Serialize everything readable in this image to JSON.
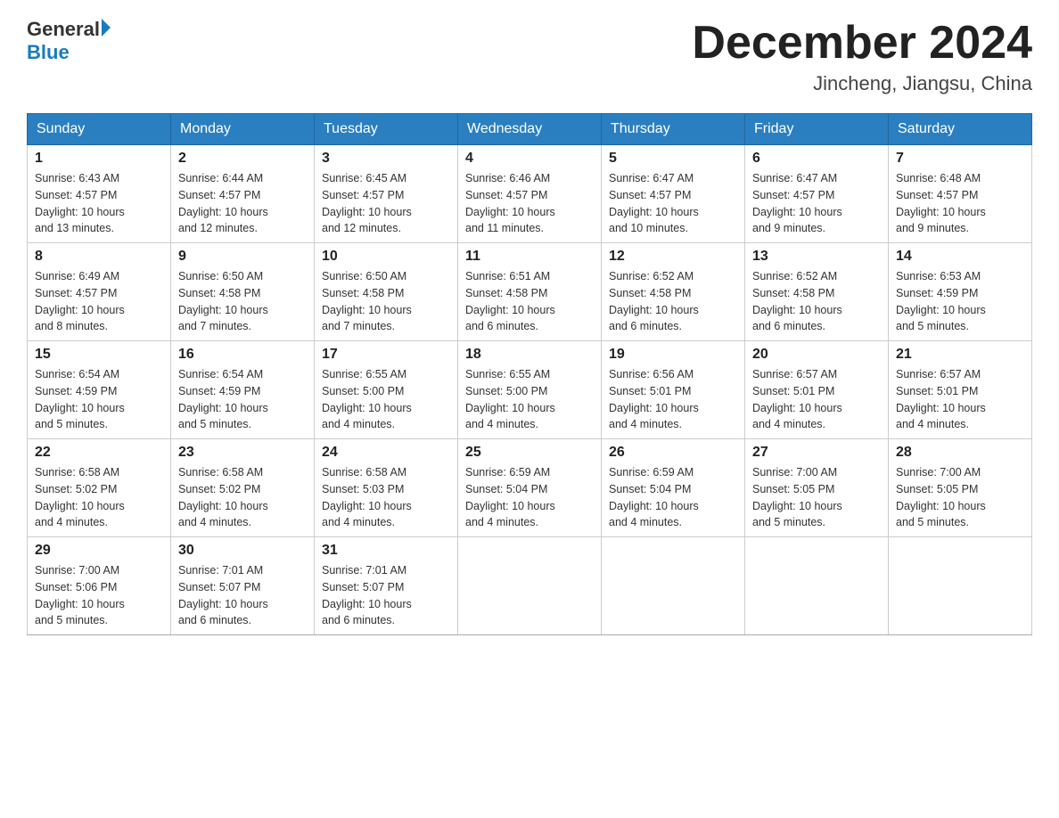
{
  "header": {
    "logo_general": "General",
    "logo_blue": "Blue",
    "month_title": "December 2024",
    "location": "Jincheng, Jiangsu, China"
  },
  "days_of_week": [
    "Sunday",
    "Monday",
    "Tuesday",
    "Wednesday",
    "Thursday",
    "Friday",
    "Saturday"
  ],
  "weeks": [
    [
      {
        "day": "1",
        "sunrise": "6:43 AM",
        "sunset": "4:57 PM",
        "daylight": "10 hours and 13 minutes."
      },
      {
        "day": "2",
        "sunrise": "6:44 AM",
        "sunset": "4:57 PM",
        "daylight": "10 hours and 12 minutes."
      },
      {
        "day": "3",
        "sunrise": "6:45 AM",
        "sunset": "4:57 PM",
        "daylight": "10 hours and 12 minutes."
      },
      {
        "day": "4",
        "sunrise": "6:46 AM",
        "sunset": "4:57 PM",
        "daylight": "10 hours and 11 minutes."
      },
      {
        "day": "5",
        "sunrise": "6:47 AM",
        "sunset": "4:57 PM",
        "daylight": "10 hours and 10 minutes."
      },
      {
        "day": "6",
        "sunrise": "6:47 AM",
        "sunset": "4:57 PM",
        "daylight": "10 hours and 9 minutes."
      },
      {
        "day": "7",
        "sunrise": "6:48 AM",
        "sunset": "4:57 PM",
        "daylight": "10 hours and 9 minutes."
      }
    ],
    [
      {
        "day": "8",
        "sunrise": "6:49 AM",
        "sunset": "4:57 PM",
        "daylight": "10 hours and 8 minutes."
      },
      {
        "day": "9",
        "sunrise": "6:50 AM",
        "sunset": "4:58 PM",
        "daylight": "10 hours and 7 minutes."
      },
      {
        "day": "10",
        "sunrise": "6:50 AM",
        "sunset": "4:58 PM",
        "daylight": "10 hours and 7 minutes."
      },
      {
        "day": "11",
        "sunrise": "6:51 AM",
        "sunset": "4:58 PM",
        "daylight": "10 hours and 6 minutes."
      },
      {
        "day": "12",
        "sunrise": "6:52 AM",
        "sunset": "4:58 PM",
        "daylight": "10 hours and 6 minutes."
      },
      {
        "day": "13",
        "sunrise": "6:52 AM",
        "sunset": "4:58 PM",
        "daylight": "10 hours and 6 minutes."
      },
      {
        "day": "14",
        "sunrise": "6:53 AM",
        "sunset": "4:59 PM",
        "daylight": "10 hours and 5 minutes."
      }
    ],
    [
      {
        "day": "15",
        "sunrise": "6:54 AM",
        "sunset": "4:59 PM",
        "daylight": "10 hours and 5 minutes."
      },
      {
        "day": "16",
        "sunrise": "6:54 AM",
        "sunset": "4:59 PM",
        "daylight": "10 hours and 5 minutes."
      },
      {
        "day": "17",
        "sunrise": "6:55 AM",
        "sunset": "5:00 PM",
        "daylight": "10 hours and 4 minutes."
      },
      {
        "day": "18",
        "sunrise": "6:55 AM",
        "sunset": "5:00 PM",
        "daylight": "10 hours and 4 minutes."
      },
      {
        "day": "19",
        "sunrise": "6:56 AM",
        "sunset": "5:01 PM",
        "daylight": "10 hours and 4 minutes."
      },
      {
        "day": "20",
        "sunrise": "6:57 AM",
        "sunset": "5:01 PM",
        "daylight": "10 hours and 4 minutes."
      },
      {
        "day": "21",
        "sunrise": "6:57 AM",
        "sunset": "5:01 PM",
        "daylight": "10 hours and 4 minutes."
      }
    ],
    [
      {
        "day": "22",
        "sunrise": "6:58 AM",
        "sunset": "5:02 PM",
        "daylight": "10 hours and 4 minutes."
      },
      {
        "day": "23",
        "sunrise": "6:58 AM",
        "sunset": "5:02 PM",
        "daylight": "10 hours and 4 minutes."
      },
      {
        "day": "24",
        "sunrise": "6:58 AM",
        "sunset": "5:03 PM",
        "daylight": "10 hours and 4 minutes."
      },
      {
        "day": "25",
        "sunrise": "6:59 AM",
        "sunset": "5:04 PM",
        "daylight": "10 hours and 4 minutes."
      },
      {
        "day": "26",
        "sunrise": "6:59 AM",
        "sunset": "5:04 PM",
        "daylight": "10 hours and 4 minutes."
      },
      {
        "day": "27",
        "sunrise": "7:00 AM",
        "sunset": "5:05 PM",
        "daylight": "10 hours and 5 minutes."
      },
      {
        "day": "28",
        "sunrise": "7:00 AM",
        "sunset": "5:05 PM",
        "daylight": "10 hours and 5 minutes."
      }
    ],
    [
      {
        "day": "29",
        "sunrise": "7:00 AM",
        "sunset": "5:06 PM",
        "daylight": "10 hours and 5 minutes."
      },
      {
        "day": "30",
        "sunrise": "7:01 AM",
        "sunset": "5:07 PM",
        "daylight": "10 hours and 6 minutes."
      },
      {
        "day": "31",
        "sunrise": "7:01 AM",
        "sunset": "5:07 PM",
        "daylight": "10 hours and 6 minutes."
      },
      null,
      null,
      null,
      null
    ]
  ],
  "labels": {
    "sunrise": "Sunrise:",
    "sunset": "Sunset:",
    "daylight": "Daylight:"
  }
}
